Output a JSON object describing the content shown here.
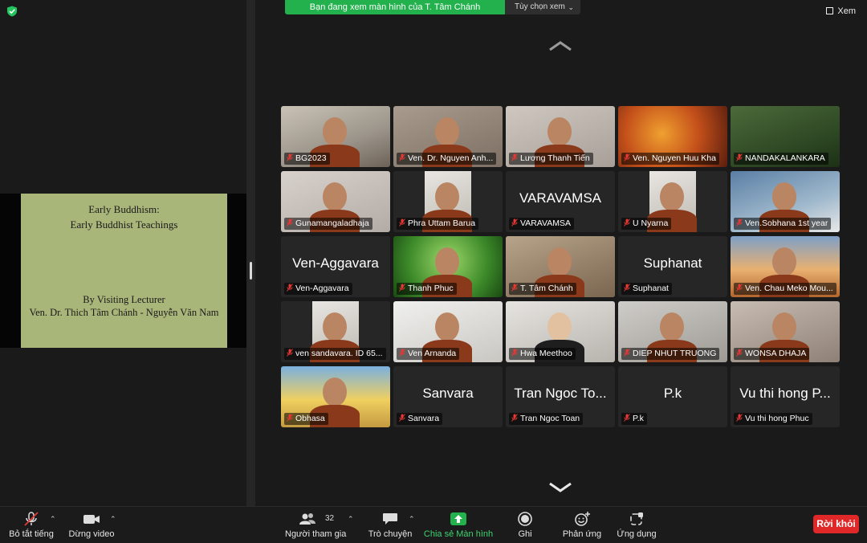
{
  "banner": {
    "text": "Bạn đang xem màn hình của T. Tâm Chánh",
    "view_options": "Tùy chọn xem"
  },
  "view_button": "Xem",
  "slide": {
    "line1": "Early Buddhism:",
    "line2": "Early Buddhist Teachings",
    "line3": "By Visiting Lecturer",
    "line4": "Ven. Dr. Thich Tâm Chánh - Nguyễn Văn Nam"
  },
  "participants": [
    {
      "name": "BG2023",
      "video": true
    },
    {
      "name": "Ven. Dr. Nguyen Anh...",
      "video": true
    },
    {
      "name": "Lương Thanh Tiến",
      "video": true
    },
    {
      "name": "Ven. Nguyen Huu Kha",
      "video": true
    },
    {
      "name": "NANDAKALANKARA",
      "video": true
    },
    {
      "name": "Gunamangaladhaja",
      "video": true
    },
    {
      "name": "Phra Uttam Barua",
      "video": true
    },
    {
      "name": "VARAVAMSA",
      "video": false,
      "big": "VARAVAMSA"
    },
    {
      "name": "U Nyarna",
      "video": true
    },
    {
      "name": "Ven.Sobhana 1st year",
      "video": true
    },
    {
      "name": "Ven-Aggavara",
      "video": false,
      "big": "Ven-Aggavara"
    },
    {
      "name": "Thanh Phuc",
      "video": true
    },
    {
      "name": "T. Tâm Chánh",
      "video": true,
      "active": true
    },
    {
      "name": "Suphanat",
      "video": false,
      "big": "Suphanat"
    },
    {
      "name": "Ven. Chau Meko Mou...",
      "video": true
    },
    {
      "name": "ven sandavara. ID 65...",
      "video": true
    },
    {
      "name": "Ven Arnanda",
      "video": true
    },
    {
      "name": "Hwa Meethoo",
      "video": true
    },
    {
      "name": "DIEP NHUT TRUONG",
      "video": true
    },
    {
      "name": "WONSA DHAJA",
      "video": true
    },
    {
      "name": "Obhasa",
      "video": true
    },
    {
      "name": "Sanvara",
      "video": false,
      "big": "Sanvara"
    },
    {
      "name": "Tran Ngoc Toan",
      "video": false,
      "big": "Tran Ngoc To..."
    },
    {
      "name": "P.k",
      "video": false,
      "big": "P.k"
    },
    {
      "name": "Vu thi hong Phuc",
      "video": false,
      "big": "Vu thi hong P..."
    }
  ],
  "toolbar": {
    "mute": "Bỏ tắt tiếng",
    "video": "Dừng video",
    "participants": "Người tham gia",
    "participants_count": "32",
    "chat": "Trò chuyện",
    "share": "Chia sẻ Màn hình",
    "record": "Ghi",
    "reactions": "Phản ứng",
    "apps": "Ứng dụng",
    "leave": "Rời khỏi"
  },
  "colors": {
    "share_green": "#22b14c",
    "leave_red": "#e02828",
    "active_border": "#3ad16c",
    "slide_bg": "#a8b67a"
  }
}
